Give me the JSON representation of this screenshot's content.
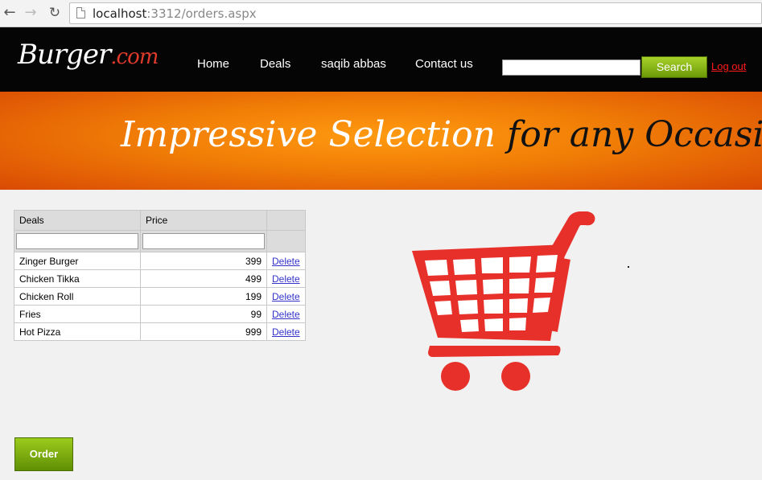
{
  "browser": {
    "url_host": "localhost",
    "url_rest": ":3312/orders.aspx",
    "back_icon": "←",
    "forward_icon": "→",
    "reload_icon": "↻"
  },
  "header": {
    "logo_main": "Burger",
    "logo_suffix": ".com",
    "menu": {
      "home": "Home",
      "deals": "Deals",
      "user": "saqib abbas",
      "contact": "Contact us"
    },
    "search": {
      "value": "",
      "button_label": "Search"
    },
    "logout_label": "Log out"
  },
  "banner": {
    "part1": "Impressive Selection",
    "part2": "for any Occasion"
  },
  "grid": {
    "headers": [
      "Deals",
      "Price",
      ""
    ],
    "filters": [
      "",
      ""
    ],
    "delete_label": "Delete",
    "rows": [
      {
        "deal": "Zinger Burger",
        "price": "399"
      },
      {
        "deal": "Chicken Tikka",
        "price": "499"
      },
      {
        "deal": "Chicken Roll",
        "price": "199"
      },
      {
        "deal": "Fries",
        "price": "99"
      },
      {
        "deal": "Hot Pizza",
        "price": "999"
      }
    ]
  },
  "cart_icon": "shopping-cart",
  "colors": {
    "accent_green": "#7fb20e",
    "cart_red": "#e8302a",
    "banner_orange": "#f07c06",
    "logout_red": "#ff1a1a"
  },
  "order_button_label": "Order"
}
